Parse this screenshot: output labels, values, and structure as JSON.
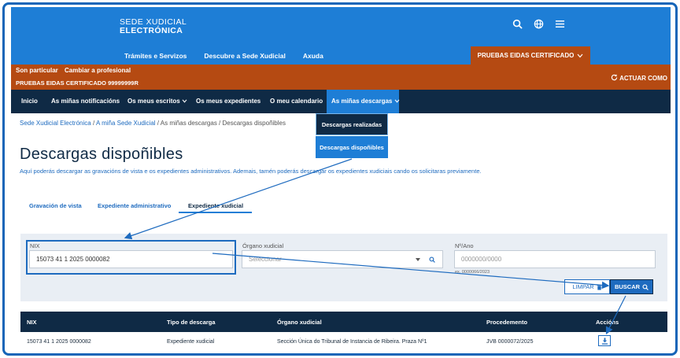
{
  "header": {
    "logo_line1": "SEDE XUDICIAL",
    "logo_line2": "ELECTRÓNICA",
    "nav": [
      "Trámites e Servizos",
      "Descubre a Sede Xudicial",
      "Axuda"
    ],
    "cert_button": "PRUEBAS EIDAS CERTIFICADO",
    "icons": [
      "search-icon",
      "globe-icon",
      "menu-icon"
    ]
  },
  "user_bar": {
    "role": "Son particular",
    "change": "Cambiar a profesional",
    "certificate": "PRUEBAS EIDAS CERTIFICADO 99999999R",
    "act_as": "ACTUAR COMO"
  },
  "main_nav": {
    "items": [
      "Inicio",
      "As miñas notificacións",
      "Os meus escritos",
      "Os meus expedientes",
      "O meu calendario",
      "As miñas descargas"
    ],
    "dropdown": [
      "Descargas realizadas",
      "Descargas dispoñibles"
    ]
  },
  "breadcrumb": {
    "link1": "Sede Xudicial Electrónica",
    "link2": "A miña Sede Xudicial",
    "rest": " / As miñas descargas / Descargas dispoñibles"
  },
  "page": {
    "title": "Descargas dispoñibles",
    "intro": "Aquí poderás descargar as gravacións de vista e os expedientes administrativos. Ademais, tamén poderás descargar os expedientes xudiciais cando os solicitaras previamente."
  },
  "tabs": [
    "Gravación de vista",
    "Expediente administrativo",
    "Expediente xudicial"
  ],
  "form": {
    "nix_label": "NIX",
    "nix_value": "15073 41 1 2025 0000082",
    "organo_label": "Órgano xudicial",
    "organo_placeholder": "Seleccionar",
    "ano_label": "Nº/Ano",
    "ano_placeholder": "0000000/0000",
    "ano_hint": "ex. 0000066/2023",
    "limpar": "LIMPAR",
    "buscar": "BUSCAR"
  },
  "table": {
    "headers": [
      "NIX",
      "Tipo de descarga",
      "Órgano xudicial",
      "Procedemento",
      "Accións"
    ],
    "rows": [
      {
        "nix": "15073 41 1 2025 0000082",
        "tipo": "Expediente xudicial",
        "organo": "Sección Única do Tribunal de Instancia de Ribeira. Praza Nº1",
        "procedemento": "JVB 0000072/2025"
      }
    ]
  },
  "colors": {
    "brand_blue": "#1e7ed6",
    "navy": "#0f2a45",
    "orange": "#b54a12"
  }
}
